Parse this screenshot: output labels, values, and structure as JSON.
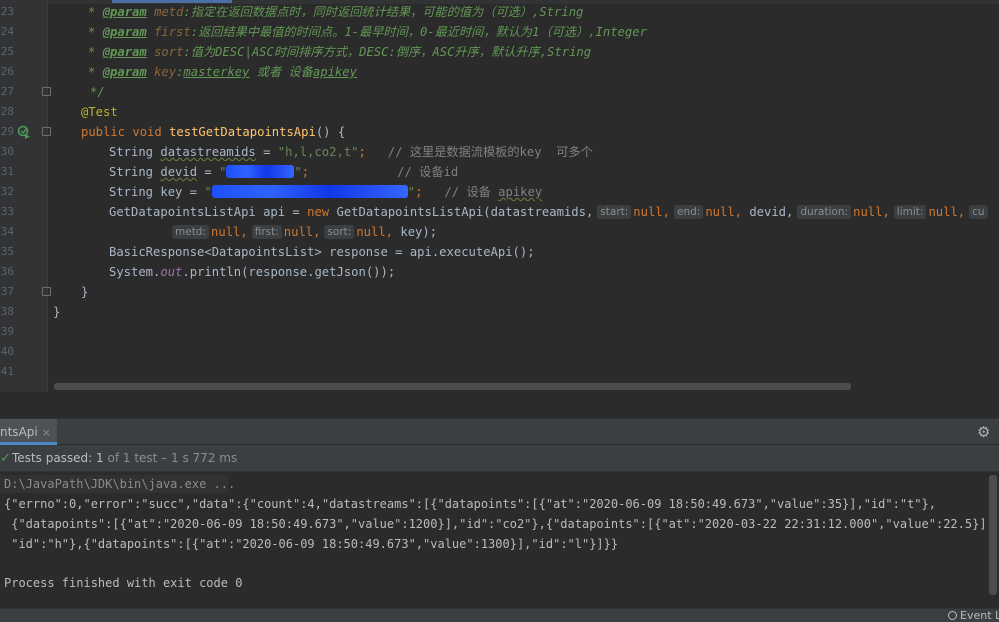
{
  "editor": {
    "line_numbers": [
      "23",
      "24",
      "25",
      "26",
      "27",
      "28",
      "29",
      "30",
      "31",
      "32",
      "33",
      "34",
      "35",
      "36",
      "37",
      "38",
      "39",
      "40",
      "41"
    ],
    "comment_lines": [
      {
        "star": "* ",
        "tag": "@param",
        "param": "metd",
        "text": ":指定在返回数据点时，同时返回统计结果，可能的值为（可选）,String"
      },
      {
        "star": "* ",
        "tag": "@param",
        "param": "first",
        "text": ":返回结果中最值的时间点。1-最早时间，0-最近时间，默认为1（可选）,Integer"
      },
      {
        "star": "* ",
        "tag": "@param",
        "param": "sort",
        "text": ":值为DESC|ASC时间排序方式，DESC:倒序，ASC升序，默认升序,String"
      },
      {
        "star": "* ",
        "tag": "@param",
        "param": "key",
        "text": ":",
        "link": "masterkey",
        "tail": " 或者 设备",
        "link2": "apikey"
      }
    ],
    "comment_end": "*/",
    "annotation": "@Test",
    "method": {
      "mods": "public void ",
      "name": "testGetDatapointsApi",
      "rest": "() {"
    },
    "line30": {
      "type": "String ",
      "var": "datastreamids",
      "eq": " = ",
      "str": "\"h,l,co2,t\"",
      "semi": ";",
      "comment": "   // 这里是数据流模板的key  可多个"
    },
    "line31": {
      "type": "String ",
      "var": "devid",
      "eq": " = ",
      "q1": "\"",
      "q2": "\"",
      "semi": ";",
      "comment": "            // 设备id"
    },
    "line32": {
      "type": "String key = ",
      "q1": "\"",
      "q2": "\"",
      "semi": ";",
      "comment": "   // 设备 ",
      "comment_link": "apikey"
    },
    "line33": {
      "head": "GetDatapointsListApi api = ",
      "kw": "new",
      "ctor": " GetDatapointsListApi(datastreamids,",
      "hint_start": "start:",
      "null1": "null,",
      "hint_end": "end:",
      "null2": "null,",
      "devid": " devid,",
      "hint_duration": "duration:",
      "null3": "null,",
      "hint_limit": "limit:",
      "null4": "null,",
      "hint_cursor": "cu"
    },
    "line34": {
      "hint_metd": "metd:",
      "null5": "null,",
      "hint_first": "first:",
      "null6": "null,",
      "hint_sort": "sort:",
      "null7": "null,",
      "tail": " key);"
    },
    "line35": {
      "text": "BasicResponse<DatapointsList> response = api.executeApi();"
    },
    "line36": {
      "a": "System.",
      "field": "out",
      "b": ".println(response.getJson());"
    },
    "close_method": "}",
    "close_class": "}"
  },
  "run_panel": {
    "tab_label": "ntsApi",
    "tab_close": "×",
    "settings_icon": "gear-icon",
    "tests_passed_label": "Tests passed:",
    "tests_passed_count": "1",
    "tests_total": "of 1 test",
    "duration": "– 1 s 772 ms",
    "command": "D:\\JavaPath\\JDK\\bin\\java.exe ...",
    "output_lines": [
      "{\"errno\":0,\"error\":\"succ\",\"data\":{\"count\":4,\"datastreams\":[{\"datapoints\":[{\"at\":\"2020-06-09 18:50:49.673\",\"value\":35}],\"id\":\"t\"},",
      " {\"datapoints\":[{\"at\":\"2020-06-09 18:50:49.673\",\"value\":1200}],\"id\":\"co2\"},{\"datapoints\":[{\"at\":\"2020-03-22 22:31:12.000\",\"value\":22.5}],",
      " \"id\":\"h\"},{\"datapoints\":[{\"at\":\"2020-06-09 18:50:49.673\",\"value\":1300}],\"id\":\"l\"}]}}"
    ],
    "exit_message": "Process finished with exit code 0"
  },
  "bottom_bar": {
    "event_log": "Event L"
  },
  "colors": {
    "editor_bg": "#2b2b2b",
    "comment": "#629755",
    "keyword": "#cc7832",
    "string": "#6a8759",
    "method": "#ffc66d",
    "annotation": "#bbb529",
    "pass_green": "#499c54",
    "tab_underline": "#4a88c7"
  }
}
